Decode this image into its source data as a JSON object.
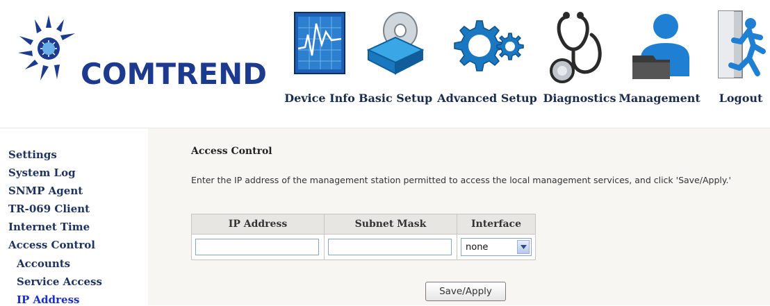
{
  "brand": {
    "logo_text": "COMTREND",
    "accent": "#1c3a8e"
  },
  "nav": [
    {
      "label": "Device Info",
      "icon": "chart-icon"
    },
    {
      "label": "Basic Setup",
      "icon": "box-disc-icon"
    },
    {
      "label": "Advanced Setup",
      "icon": "gears-icon"
    },
    {
      "label": "Diagnostics",
      "icon": "stethoscope-icon"
    },
    {
      "label": "Management",
      "icon": "user-folder-icon"
    },
    {
      "label": "Logout",
      "icon": "exit-icon"
    }
  ],
  "sidebar": {
    "items": [
      {
        "label": "Settings"
      },
      {
        "label": "System Log"
      },
      {
        "label": "SNMP Agent"
      },
      {
        "label": "TR-069 Client"
      },
      {
        "label": "Internet Time"
      },
      {
        "label": "Access Control"
      },
      {
        "label": "Accounts"
      },
      {
        "label": "Service Access"
      },
      {
        "label": "IP Address"
      }
    ],
    "active": "IP Address"
  },
  "main": {
    "title": "Access Control",
    "description": "Enter the IP address of the management station permitted to access the local management services, and click 'Save/Apply.'",
    "table": {
      "headers": [
        "IP Address",
        "Subnet Mask",
        "Interface"
      ],
      "row": {
        "ip_value": "",
        "mask_value": "",
        "interface_value": "none"
      }
    },
    "save_label": "Save/Apply"
  }
}
